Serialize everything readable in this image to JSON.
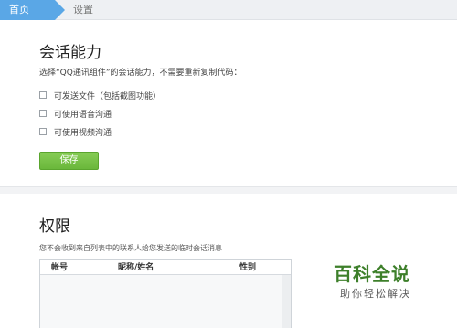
{
  "breadcrumb": {
    "home": "首页",
    "current": "设置"
  },
  "chat_ability": {
    "title": "会话能力",
    "description": "选择“QQ通讯组件”的会话能力，不需要重新复制代码：",
    "options": [
      {
        "label": "可发送文件（包括截图功能）",
        "checked": false
      },
      {
        "label": "可使用语音沟通",
        "checked": false
      },
      {
        "label": "可使用视频沟通",
        "checked": false
      }
    ],
    "save_label": "保存"
  },
  "permissions": {
    "title": "权限",
    "description": "您不会收到来自列表中的联系人给您发送的临时会话消息",
    "table": {
      "columns": [
        "帐号",
        "昵称/姓名",
        "性别"
      ]
    }
  },
  "watermark": {
    "title": "百科全说",
    "subtitle": "助你轻松解决"
  },
  "colors": {
    "breadcrumb_active": "#5aa7e6",
    "save_button": "#6ab73b",
    "watermark": "#3d7f2a"
  }
}
